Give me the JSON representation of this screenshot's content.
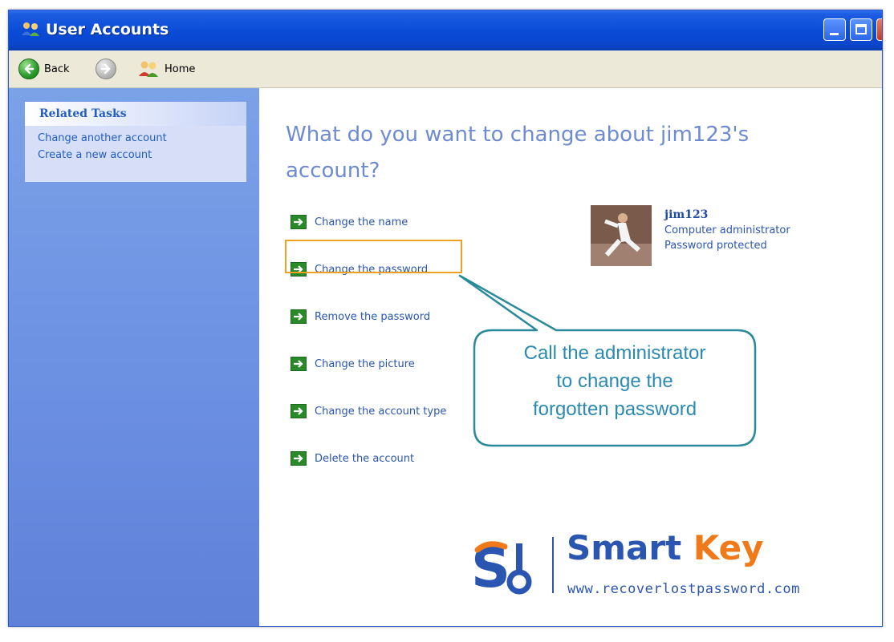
{
  "window": {
    "title": "User Accounts",
    "controls": [
      "minimize",
      "maximize",
      "close"
    ]
  },
  "toolbar": {
    "back_label": "Back",
    "home_label": "Home"
  },
  "sidebar": {
    "related_tasks": {
      "title": "Related Tasks",
      "links": [
        {
          "label": "Change another account"
        },
        {
          "label": "Create a new account"
        }
      ]
    }
  },
  "main": {
    "heading_line1": "What do you want to change about jim123's",
    "heading_line2": "account?",
    "actions": [
      {
        "label": "Change the name",
        "icon": "green-arrow-icon"
      },
      {
        "label": "Change the password",
        "icon": "green-arrow-icon",
        "highlighted": true
      },
      {
        "label": "Remove the password",
        "icon": "green-arrow-icon"
      },
      {
        "label": "Change the picture",
        "icon": "green-arrow-icon"
      },
      {
        "label": "Change the account type",
        "icon": "green-arrow-icon"
      },
      {
        "label": "Delete the account",
        "icon": "green-arrow-icon"
      }
    ],
    "user": {
      "name": "jim123",
      "role": "Computer administrator",
      "password_status": "Password protected"
    }
  },
  "callout": {
    "line1": "Call the administrator",
    "line2": "to change the",
    "line3": "forgotten password"
  },
  "logo": {
    "name_part1": "Smart ",
    "name_part2": "Key",
    "url": "www.recoverlostpassword.com"
  },
  "colors": {
    "titlebar": "#0a4bd6",
    "sidebar": "#6a8ee2",
    "heading": "#6e8ad2",
    "link": "#2a55b0",
    "highlight": "#f0a020",
    "callout_border": "#2a8a9a",
    "callout_text": "#2a8ab0",
    "logo_blue": "#2a55b0",
    "logo_orange": "#f07a1a"
  }
}
